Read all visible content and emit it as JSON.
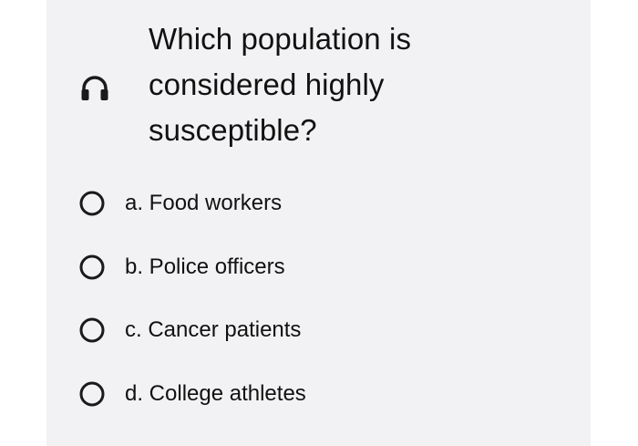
{
  "question": {
    "text": "Which population is considered highly susceptible?",
    "audio_icon": "headphones-icon"
  },
  "options": [
    {
      "label": "a. Food workers",
      "selected": false
    },
    {
      "label": "b. Police officers",
      "selected": false
    },
    {
      "label": "c. Cancer patients",
      "selected": false
    },
    {
      "label": "d. College athletes",
      "selected": false
    }
  ],
  "colors": {
    "card_background": "#f2f2f4",
    "text": "#111111",
    "radio_border": "#1a1a1a"
  }
}
